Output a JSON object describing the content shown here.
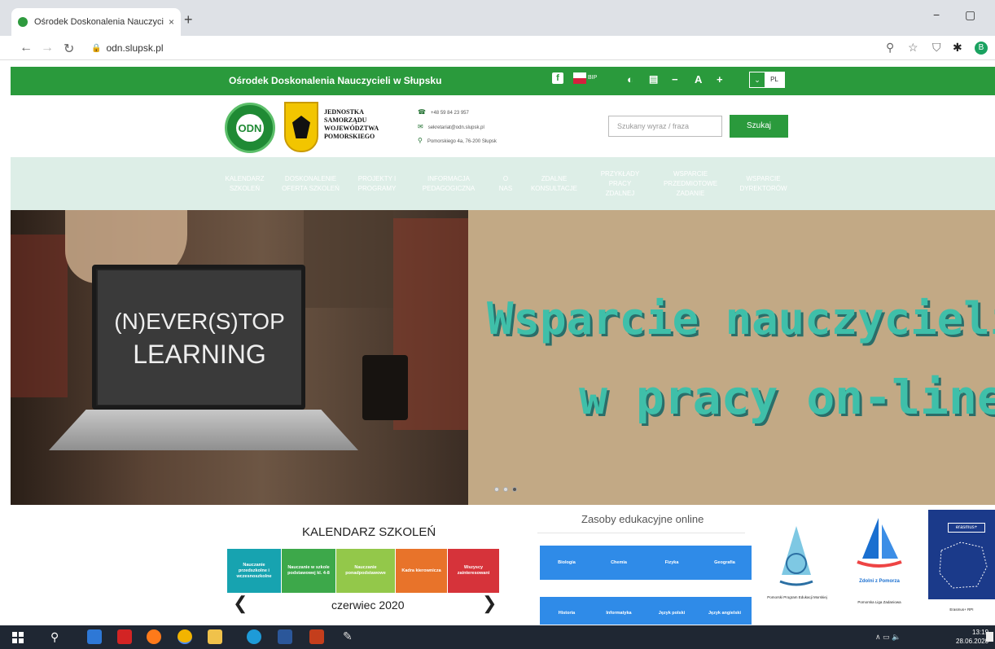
{
  "browser": {
    "tab_title": "Ośrodek Doskonalenia Nauczycieli",
    "tab_close": "×",
    "new_tab": "+",
    "url": "odn.slupsk.pl",
    "minimize": "−",
    "maximize": "▢",
    "profile_initial": "B"
  },
  "topbar": {
    "site_name": "Ośrodek Doskonalenia Nauczycieli w Słupsku",
    "facebook": "f",
    "bip": "BIP",
    "contrast": "◐",
    "font_minus": "−",
    "font_a": "A",
    "font_plus": "+",
    "lang_arrow": "⌄",
    "lang": "PL"
  },
  "header": {
    "odn_logo_text": "ODN",
    "jst_lines": [
      "JEDNOSTKA",
      "SAMORZĄDU",
      "WOJEWÓDZTWA",
      "POMORSKIEGO"
    ],
    "phone": "+48 59 84 23 957",
    "email": "sekretariat@odn.slupsk.pl",
    "address": "Pomorskiego 4a, 76-200 Słupsk",
    "search_placeholder": "Szukany wyraz / fraza",
    "search_button": "Szukaj"
  },
  "nav": {
    "items": [
      {
        "label": "KALENDARZ SZKOLEŃ",
        "color": "#c8372d"
      },
      {
        "label": "DOSKONALENIE OFERTA SZKOLEŃ",
        "color": "#e8732a"
      },
      {
        "label": "PROJEKTY I PROGRAMY",
        "color": "#2f8ad6"
      },
      {
        "label": "INFORMACJA PEDAGOGICZNA",
        "color": "#18a6b7"
      },
      {
        "label": "O NAS",
        "color": "#8fbf7a"
      },
      {
        "label": "ZDALNE KONSULTACJE",
        "color": "#2aa148"
      },
      {
        "label": "PRZYKŁADY PRACY ZDALNEJ",
        "color": "#1d5fd6"
      },
      {
        "label": "WSPARCIE PRZEDMIOTOWE ZADANIE",
        "color": "#8fe08a"
      },
      {
        "label": "WSPARCIE DYREKTORÓW",
        "color": "#f0e21e"
      }
    ]
  },
  "hero": {
    "laptop_line1": "(N)EVER(S)TOP",
    "laptop_line2": "LEARNING",
    "slogan_line1": "Wsparcie nauczycieli",
    "slogan_line2": "w pracy on-line",
    "slides": 3,
    "active_slide": 3
  },
  "calendar": {
    "title": "KALENDARZ SZKOLEŃ",
    "categories": [
      {
        "label": "Nauczanie przedszkolne i wczesnoszkolne",
        "color": "#17a3b0"
      },
      {
        "label": "Nauczanie w szkole podstawowej kl. 4-8",
        "color": "#3da84a"
      },
      {
        "label": "Nauczanie ponadpodstawowe",
        "color": "#93c84a"
      },
      {
        "label": "Kadra kierownicza",
        "color": "#e8732a"
      },
      {
        "label": "Wszyscy zainteresowani",
        "color": "#d6333a"
      }
    ],
    "prev": "❮",
    "month": "czerwiec 2020",
    "next": "❯"
  },
  "resources": {
    "title": "Zasoby edukacyjne online",
    "tiles": [
      "Biologia",
      "Chemia",
      "Fizyka",
      "Geografia",
      "Historia",
      "Informatyka",
      "Język polski",
      "Język angielski"
    ]
  },
  "partners": [
    {
      "caption": "Pomorski Program Edukacji Morskiej"
    },
    {
      "caption": "Pomorska Liga Zadaniowa",
      "logo_text": "Zdolni z Pomorza"
    },
    {
      "caption": "Erasmus+ RPI",
      "logo_text": "erasmus+"
    }
  ],
  "taskbar": {
    "time": "13:19",
    "date": "28.06.2020",
    "tray": "∧ ▭ 🔈"
  }
}
